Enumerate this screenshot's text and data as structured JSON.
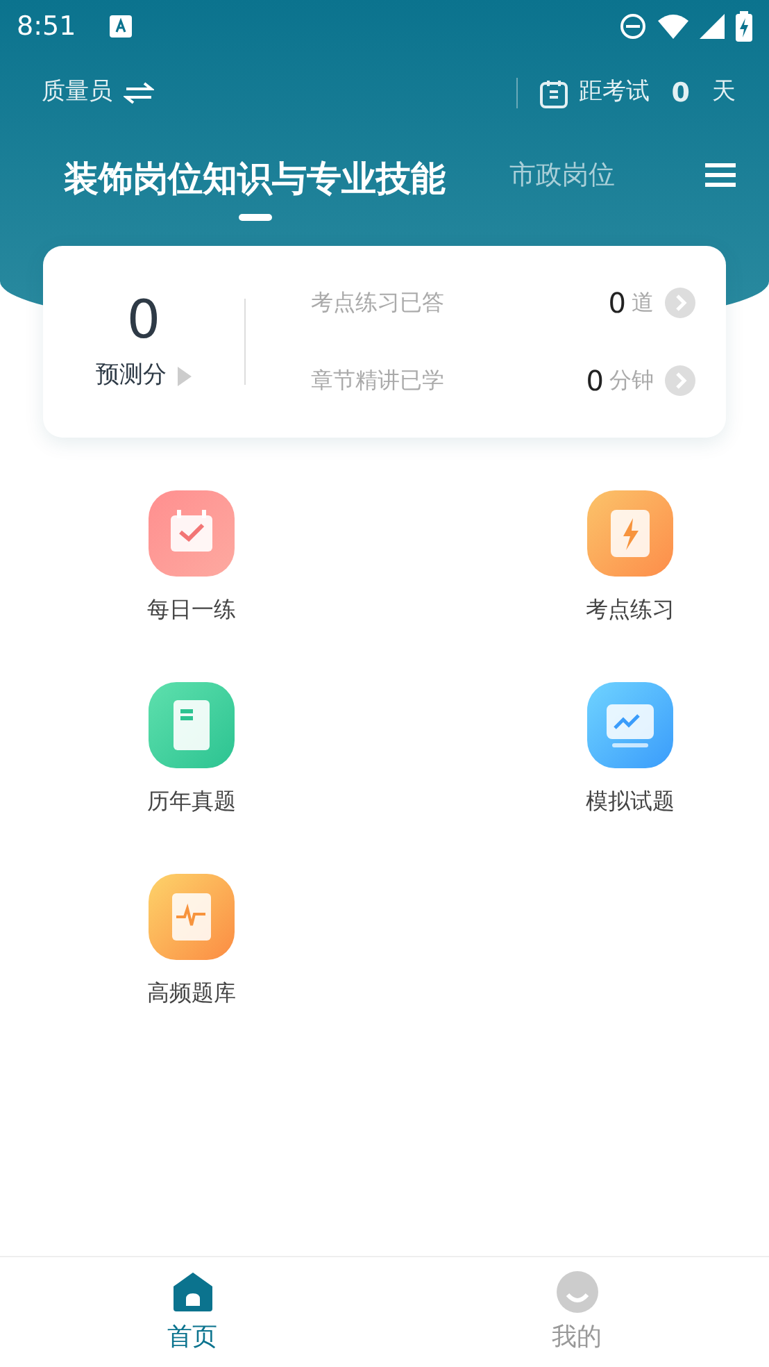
{
  "status_bar": {
    "time": "8:51"
  },
  "header": {
    "role": "质量员",
    "exam_label": "距考试",
    "exam_days": "0",
    "exam_unit": "天"
  },
  "tabs": [
    {
      "label": "装饰岗位知识与专业技能",
      "selected": true
    },
    {
      "label": "市政岗位",
      "selected": false
    }
  ],
  "score_card": {
    "score": "0",
    "score_label": "预测分",
    "stats": [
      {
        "label": "考点练习已答",
        "value": "0",
        "unit": "道"
      },
      {
        "label": "章节精讲已学",
        "value": "0",
        "unit": "分钟"
      }
    ]
  },
  "features": [
    {
      "label": "每日一练"
    },
    {
      "label": "考点练习"
    },
    {
      "label": "历年真题"
    },
    {
      "label": "模拟试题"
    },
    {
      "label": "高频题库"
    }
  ],
  "bottom_nav": [
    {
      "label": "首页",
      "selected": true
    },
    {
      "label": "我的",
      "selected": false
    }
  ]
}
